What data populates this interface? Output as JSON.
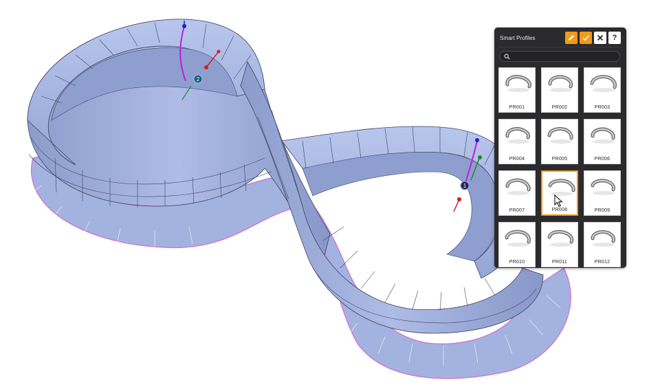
{
  "panel": {
    "title": "Smart Profiles",
    "toolbar": {
      "edit_icon": "pencil-icon",
      "confirm_icon": "check-icon",
      "close_icon": "close-icon",
      "help_label": "?"
    },
    "search": {
      "placeholder": "",
      "value": "",
      "icon": "search-icon"
    },
    "profiles": [
      {
        "label": "PR001",
        "selected": false
      },
      {
        "label": "PR002",
        "selected": false
      },
      {
        "label": "PR003",
        "selected": false
      },
      {
        "label": "PR004",
        "selected": false
      },
      {
        "label": "PR005",
        "selected": false
      },
      {
        "label": "PR006",
        "selected": false
      },
      {
        "label": "PR007",
        "selected": false
      },
      {
        "label": "PR008",
        "selected": true
      },
      {
        "label": "PR009",
        "selected": false
      },
      {
        "label": "PR010",
        "selected": false
      },
      {
        "label": "PR011",
        "selected": false
      },
      {
        "label": "PR012",
        "selected": false
      }
    ]
  },
  "viewport": {
    "markers": [
      {
        "label": "1"
      },
      {
        "label": "2"
      }
    ],
    "colors": {
      "surface": "#a9b9e4",
      "mesh_lines": "#3a4260",
      "outline": "#d07ad6",
      "rail_magenta": "#c21bd8",
      "accent": "#f29a1a"
    }
  }
}
